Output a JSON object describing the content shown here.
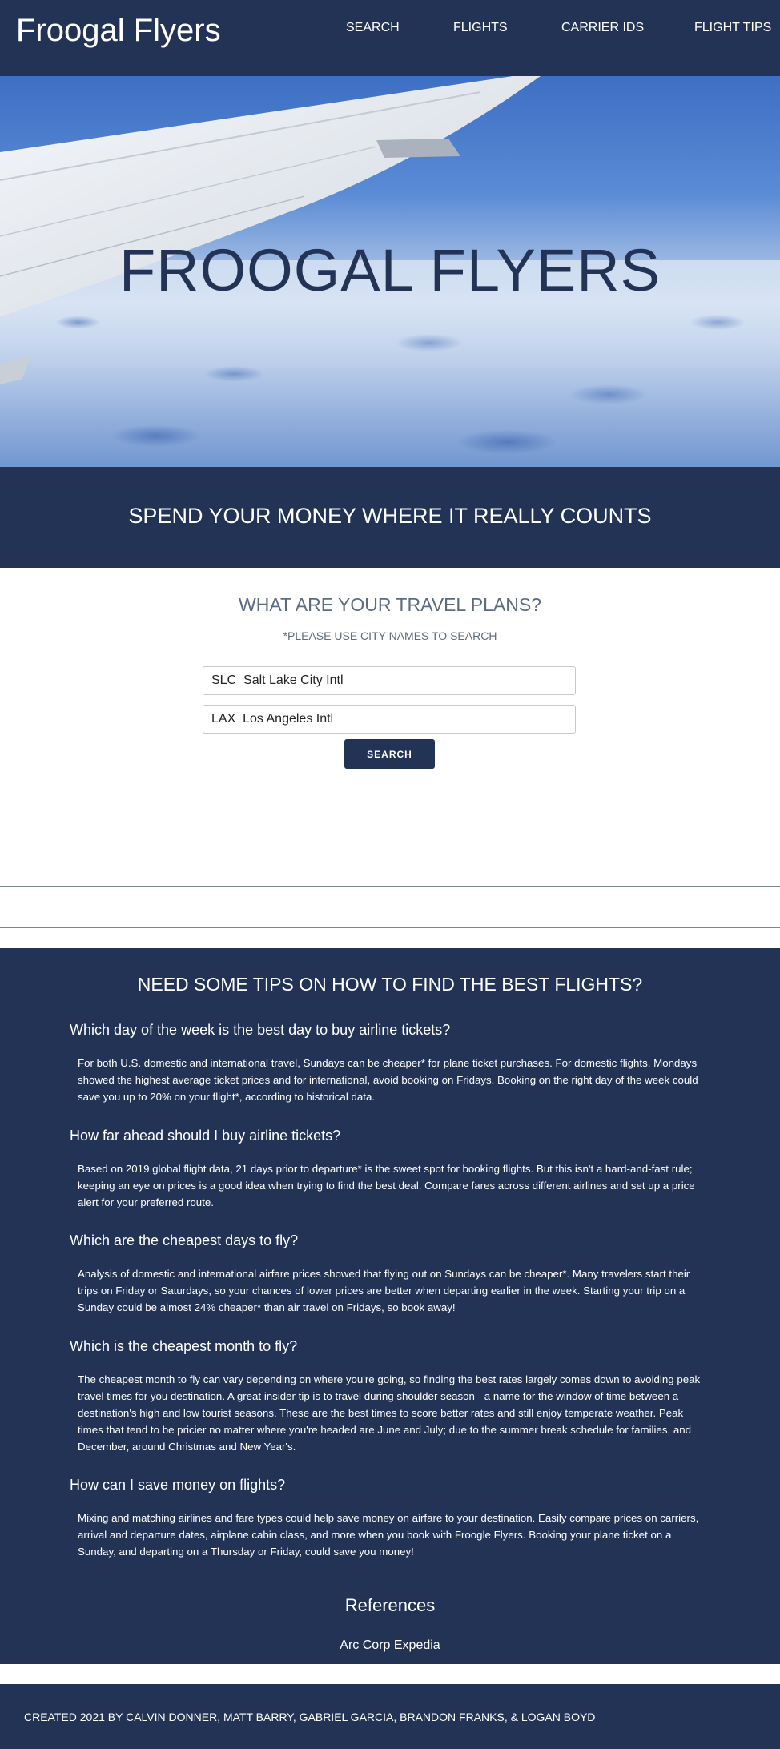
{
  "header": {
    "logo": "Froogal Flyers",
    "nav": [
      "SEARCH",
      "FLIGHTS",
      "CARRIER IDS",
      "FLIGHT TIPS"
    ]
  },
  "hero": {
    "title": "FROOGAL FLYERS"
  },
  "tagline": "SPEND YOUR MONEY WHERE IT REALLY COUNTS",
  "search": {
    "title": "WHAT ARE YOUR TRAVEL PLANS?",
    "note": "*PLEASE USE CITY NAMES TO SEARCH",
    "origin_value": "SLC  Salt Lake City Intl",
    "destination_value": "LAX  Los Angeles Intl",
    "button_label": "SEARCH"
  },
  "tips": {
    "title": "NEED SOME TIPS ON HOW TO FIND THE BEST FLIGHTS?",
    "items": [
      {
        "question": "Which day of the week is the best day to buy airline tickets?",
        "answer": "For both U.S. domestic and international travel, Sundays can be cheaper* for plane ticket purchases. For domestic flights, Mondays showed the highest average ticket prices and for international, avoid booking on Fridays. Booking on the right day of the week could save you up to 20% on your flight*, according to historical data."
      },
      {
        "question": "How far ahead should I buy airline tickets?",
        "answer": "Based on 2019 global flight data, 21 days prior to departure* is the sweet spot for booking flights. But this isn't a hard-and-fast rule; keeping an eye on prices is a good idea when trying to find the best deal. Compare fares across different airlines and set up a price alert for your preferred route."
      },
      {
        "question": "Which are the cheapest days to fly?",
        "answer": "Analysis of domestic and international airfare prices showed that flying out on Sundays can be cheaper*. Many travelers start their trips on Friday or Saturdays, so your chances of lower prices are better when departing earlier in the week. Starting your trip on a Sunday could be almost 24% cheaper* than air travel on Fridays, so book away!"
      },
      {
        "question": "Which is the cheapest month to fly?",
        "answer": "The cheapest month to fly can vary depending on where you're going, so finding the best rates largely comes down to avoiding peak travel times for you destination. A great insider tip is to travel during shoulder season - a name for the window of time between a destination's high and low tourist seasons. These are the best times to score better rates and still enjoy temperate weather. Peak times that tend to be pricier no matter where you're headed are June and July; due to the summer break schedule for families, and December, around Christmas and New Year's."
      },
      {
        "question": "How can I save money on flights?",
        "answer": "Mixing and matching airlines and fare types could help save money on airfare to your destination. Easily compare prices on carriers, arrival and departure dates, airplane cabin class, and more when you book with Froogle Flyers. Booking your plane ticket on a Sunday, and departing on a Thursday or Friday, could save you money!"
      }
    ],
    "references_title": "References",
    "references": [
      "Arc Corp",
      "Expedia"
    ]
  },
  "footer": {
    "credit": "CREATED 2021 BY CALVIN DONNER, MATT BARRY, GABRIEL GARCIA, BRANDON FRANKS, & LOGAN BOYD"
  },
  "colors": {
    "navy": "#223356",
    "muted_text": "#5d6b80"
  },
  "icons": [
    "airplane-wing-image"
  ]
}
